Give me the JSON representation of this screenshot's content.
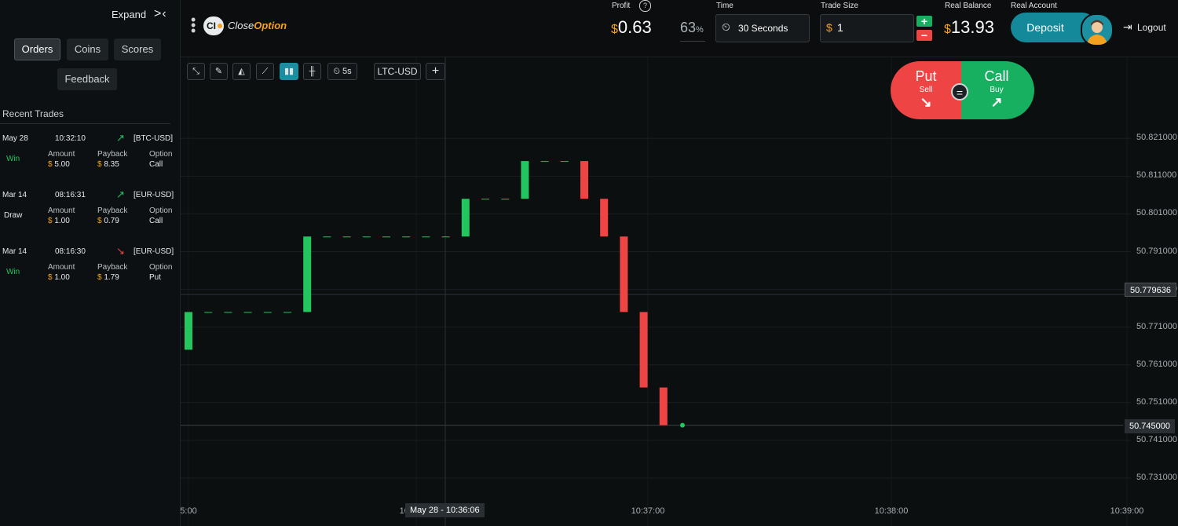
{
  "sidebar": {
    "expand_label": "Expand",
    "expand_icon": ">‹",
    "tabs": [
      "Orders",
      "Coins",
      "Scores"
    ],
    "feedback_label": "Feedback",
    "recent_title": "Recent Trades",
    "trades": [
      {
        "date": "May 28",
        "time": "10:32:10",
        "direction": "up",
        "pair": "[BTC-USD]",
        "result": "Win",
        "amount_label": "Amount",
        "amount": "5.00",
        "payback_label": "Payback",
        "payback": "8.35",
        "option_label": "Option",
        "option": "Call"
      },
      {
        "date": "Mar 14",
        "time": "08:16:31",
        "direction": "up",
        "pair": "[EUR-USD]",
        "result": "Draw",
        "amount_label": "Amount",
        "amount": "1.00",
        "payback_label": "Payback",
        "payback": "0.79",
        "option_label": "Option",
        "option": "Call"
      },
      {
        "date": "Mar 14",
        "time": "08:16:30",
        "direction": "down",
        "pair": "[EUR-USD]",
        "result": "Win",
        "amount_label": "Amount",
        "amount": "1.00",
        "payback_label": "Payback",
        "payback": "1.79",
        "option_label": "Option",
        "option": "Put"
      }
    ],
    "currency_symbol": "$"
  },
  "header": {
    "brand_badge": "CI",
    "brand_name_plain": "Close",
    "brand_name_accent": "Option",
    "profit_label": "Profit",
    "profit_value": "0.63",
    "percent": "63",
    "percent_sign": "%",
    "time_label": "Time",
    "time_value": "30 Seconds",
    "trade_size_label": "Trade Size",
    "trade_size_value": "1",
    "balance_label": "Real Balance",
    "balance_value": "13.93",
    "account_label": "Real Account",
    "deposit_label": "Deposit",
    "logout_label": "Logout",
    "plus": "+",
    "minus": "−"
  },
  "toolbar": {
    "interval": "5s",
    "pair": "LTC-USD",
    "add": "+"
  },
  "trade_buttons": {
    "put": "Put",
    "put_sub": "Sell",
    "call": "Call",
    "call_sub": "Buy",
    "equal": "="
  },
  "chart_data": {
    "type": "candlestick",
    "pair": "LTC-USD",
    "y_ticks": [
      "50.821000",
      "50.811000",
      "50.801000",
      "50.791000",
      "50.781000",
      "50.771000",
      "50.761000",
      "50.751000",
      "50.741000",
      "50.731000"
    ],
    "x_ticks": [
      "5:00",
      "10:36:00",
      "10:37:00",
      "10:38:00",
      "10:39:00"
    ],
    "crosshair_label": "May 28 - 10:36:06",
    "crosshair_price": "50.779636",
    "current_price": "50.745000",
    "candles": [
      {
        "open": 50.765,
        "close": 50.775
      },
      {
        "open": 50.775,
        "close": 50.775
      },
      {
        "open": 50.775,
        "close": 50.775
      },
      {
        "open": 50.775,
        "close": 50.775
      },
      {
        "open": 50.775,
        "close": 50.775
      },
      {
        "open": 50.775,
        "close": 50.775
      },
      {
        "open": 50.775,
        "close": 50.795
      },
      {
        "open": 50.795,
        "close": 50.795
      },
      {
        "open": 50.795,
        "close": 50.795
      },
      {
        "open": 50.795,
        "close": 50.795
      },
      {
        "open": 50.795,
        "close": 50.795
      },
      {
        "open": 50.795,
        "close": 50.795
      },
      {
        "open": 50.795,
        "close": 50.795
      },
      {
        "open": 50.795,
        "close": 50.795
      },
      {
        "open": 50.795,
        "close": 50.805
      },
      {
        "open": 50.805,
        "close": 50.805
      },
      {
        "open": 50.805,
        "close": 50.805
      },
      {
        "open": 50.805,
        "close": 50.815
      },
      {
        "open": 50.815,
        "close": 50.815
      },
      {
        "open": 50.815,
        "close": 50.815
      },
      {
        "open": 50.815,
        "close": 50.805
      },
      {
        "open": 50.805,
        "close": 50.795
      },
      {
        "open": 50.795,
        "close": 50.775
      },
      {
        "open": 50.775,
        "close": 50.755
      },
      {
        "open": 50.755,
        "close": 50.745
      }
    ],
    "up_color": "#22c55e",
    "down_color": "#ef4444",
    "ylim": [
      50.726,
      50.83
    ]
  },
  "colors": {
    "accent": "#1d8ea0",
    "dollar": "#f4a11f",
    "win": "#22c55e",
    "loss": "#ef4444"
  }
}
